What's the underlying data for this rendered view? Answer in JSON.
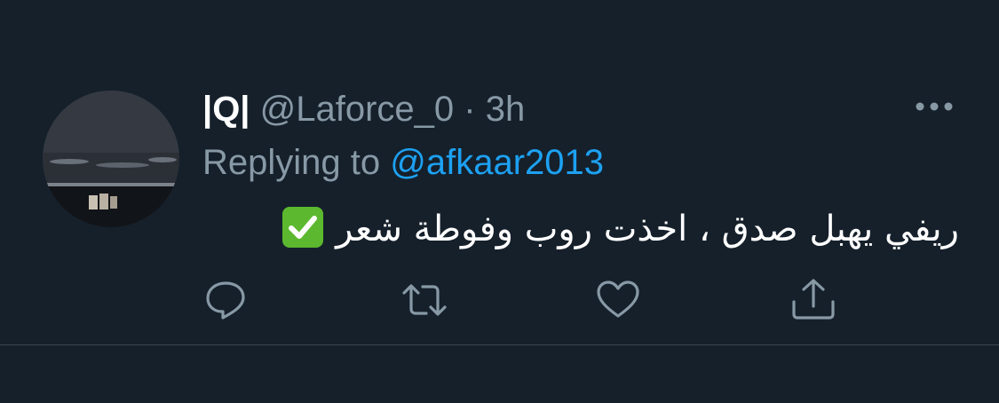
{
  "tweet": {
    "display_name": "|Q|",
    "handle": "@Laforce_0",
    "separator": "·",
    "time": "3h",
    "replying_prefix": "Replying to ",
    "replying_handle": "@afkaar2013",
    "text": "ريفي يهبل صدق ، اخذت روب وفوطة شعر",
    "emoji": "check-mark-button-emoji"
  },
  "icons": {
    "more": "more-horizontal-icon",
    "reply": "reply-icon",
    "retweet": "retweet-icon",
    "like": "like-icon",
    "share": "share-icon"
  },
  "colors": {
    "background": "#15202b",
    "primary_text": "#ffffff",
    "secondary_text": "#8899a6",
    "link": "#1da1f2",
    "divider": "#38444d",
    "check_green": "#5cb82e"
  }
}
